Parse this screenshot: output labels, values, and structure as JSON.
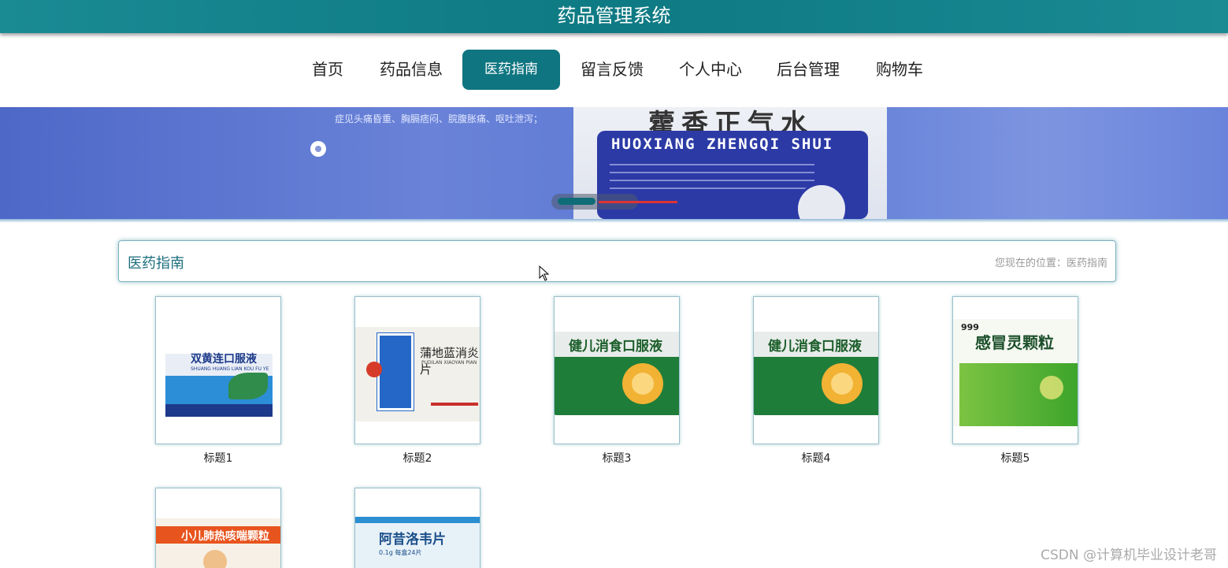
{
  "header": {
    "title": "药品管理系统"
  },
  "nav": {
    "items": [
      {
        "label": "首页"
      },
      {
        "label": "药品信息"
      },
      {
        "label": "医药指南",
        "active": true
      },
      {
        "label": "留言反馈"
      },
      {
        "label": "个人中心"
      },
      {
        "label": "后台管理"
      },
      {
        "label": "购物车"
      }
    ]
  },
  "banner": {
    "tagline": "症见头痛昏重、胸膈痞闷、脘腹胀痛、呕吐泄泻；",
    "product_name": "藿香正气水",
    "product_pinyin": "HUOXIANG ZHENGQI SHUI"
  },
  "section": {
    "title": "医药指南",
    "breadcrumb": "您现在的位置：医药指南"
  },
  "cards": [
    {
      "caption": "标题1",
      "pkg_name": "双黄连口服液",
      "pkg_pinyin": "SHUANG HUANG LIAN KOU FU YE"
    },
    {
      "caption": "标题2",
      "pkg_name": "蒲地蓝消炎片",
      "pkg_pinyin": "PUDILAN XIAOYAN PIAN"
    },
    {
      "caption": "标题3",
      "pkg_name": "健儿消食口服液"
    },
    {
      "caption": "标题4",
      "pkg_name": "健儿消食口服液"
    },
    {
      "caption": "标题5",
      "pkg_name": "感冒灵颗粒",
      "pkg_brand": "999"
    },
    {
      "caption": "",
      "pkg_name": "小儿肺热咳喘颗粒"
    },
    {
      "caption": "",
      "pkg_name": "阿昔洛韦片",
      "pkg_sub": "0.1g 每盒24片"
    }
  ],
  "watermark": "CSDN @计算机毕业设计老哥",
  "colors": {
    "primary": "#0f7580",
    "header": "#1a8a93",
    "banner": "#5a77d4"
  }
}
